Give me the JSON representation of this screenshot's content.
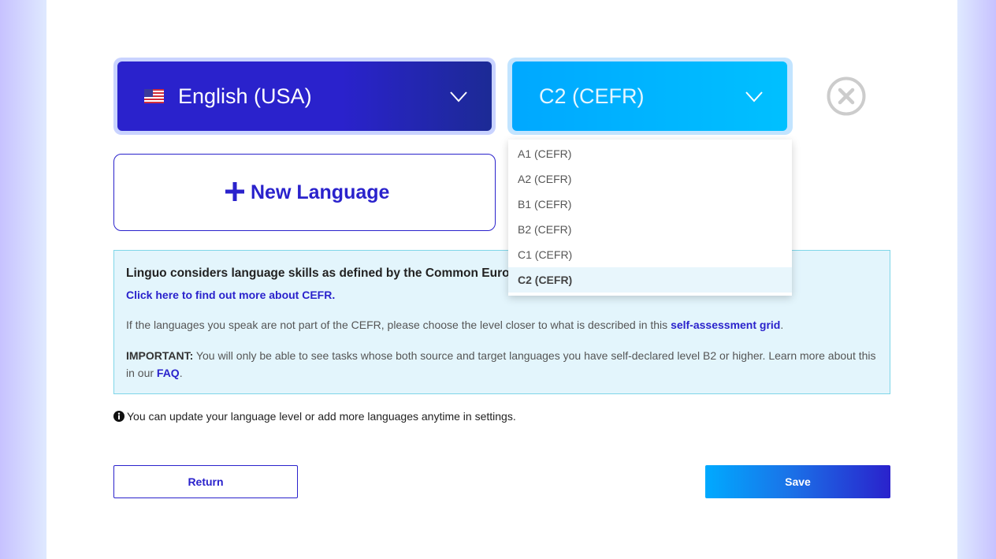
{
  "language_select": {
    "flag_icon": "us-flag-icon",
    "value": "English (USA)"
  },
  "level_select": {
    "value": "C2 (CEFR)"
  },
  "dropdown": {
    "options": [
      "A1 (CEFR)",
      "A2 (CEFR)",
      "B1 (CEFR)",
      "B2 (CEFR)",
      "C1 (CEFR)",
      "C2 (CEFR)"
    ],
    "selected": "C2 (CEFR)"
  },
  "new_language_button": {
    "label": "New Language"
  },
  "info": {
    "heading": "Linguo considers language skills as defined by the Common European",
    "cefr_link": "Click here to find out more about CEFR.",
    "para1_text": "If the languages you speak are not part of the CEFR, please choose the level closer to what is described in this ",
    "para1_link": "self-assessment grid",
    "para1_end": ".",
    "para2_strong": "IMPORTANT:",
    "para2_text": " You will only be able to see tasks whose both source and target languages you have self-declared level B2 or higher. Learn more about this in our ",
    "para2_link": "FAQ",
    "para2_end": "."
  },
  "note": {
    "text": "You can update your language level or add more languages anytime in settings."
  },
  "buttons": {
    "return_label": "Return",
    "save_label": "Save"
  },
  "colors": {
    "brand_blue": "#2a22cc",
    "accent_cyan": "#00b4ff",
    "info_bg": "#e3f5fc"
  }
}
